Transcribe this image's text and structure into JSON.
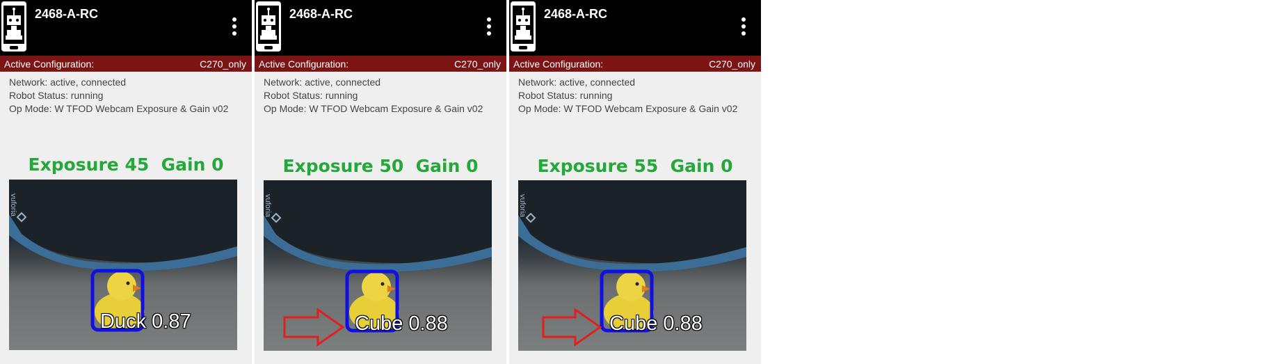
{
  "panels": [
    {
      "device_name": "2468-A-RC",
      "config_label": "Active Configuration:",
      "config_value": "C270_only",
      "network": "Network: active, connected",
      "robot_status": "Robot Status: running",
      "op_mode": "Op Mode: W TFOD Webcam Exposure & Gain v02",
      "caption": "Exposure 45  Gain 0",
      "detection_label": "Duck 0.87",
      "watermark": "vuforia",
      "show_arrow": false
    },
    {
      "device_name": "2468-A-RC",
      "config_label": "Active Configuration:",
      "config_value": "C270_only",
      "network": "Network: active, connected",
      "robot_status": "Robot Status: running",
      "op_mode": "Op Mode: W TFOD Webcam Exposure & Gain v02",
      "caption": "Exposure 50  Gain 0",
      "detection_label": "Cube 0.88",
      "watermark": "vuforia",
      "show_arrow": true
    },
    {
      "device_name": "2468-A-RC",
      "config_label": "Active Configuration:",
      "config_value": "C270_only",
      "network": "Network: active, connected",
      "robot_status": "Robot Status: running",
      "op_mode": "Op Mode: W TFOD Webcam Exposure & Gain v02",
      "caption": "Exposure 55  Gain 0",
      "detection_label": "Cube 0.88",
      "watermark": "vuforia",
      "show_arrow": true
    }
  ],
  "icons": {
    "app": "robot-phone-icon",
    "menu": "overflow-menu-icon",
    "arrow": "red-outline-arrow-icon"
  },
  "colors": {
    "topbar": "#000000",
    "config_bar": "#7d1414",
    "caption_green": "#24a839",
    "detection_box": "#1010e0",
    "arrow_red": "#e0201c"
  }
}
